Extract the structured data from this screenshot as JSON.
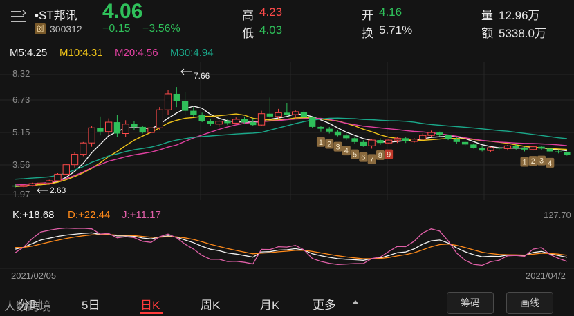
{
  "header": {
    "menu_icon": "list-menu-icon",
    "stock_name": "•ST邦讯",
    "badge": "创",
    "code": "300312",
    "price": "4.06",
    "change": "−0.15",
    "change_pct": "−3.56%",
    "high_label": "高",
    "high": "4.23",
    "low_label": "低",
    "low": "4.03",
    "open_label": "开",
    "open": "4.16",
    "turnover_label": "换",
    "turnover": "5.71%",
    "volume_label": "量",
    "volume": "12.96万",
    "amount_label": "额",
    "amount": "5338.0万",
    "colors": {
      "up": "#ff4a4a",
      "down": "#2fc05a",
      "bg": "#141414"
    }
  },
  "ma_legend": {
    "m5": "M5:4.25",
    "m10": "M10:4.31",
    "m20": "M20:4.56",
    "m30": "M30:4.94",
    "colors": {
      "m5": "#f2f2f2",
      "m10": "#f0c419",
      "m20": "#e040a0",
      "m30": "#1aa88a"
    }
  },
  "price_axis": {
    "t1": "8.32",
    "t2": "6.73",
    "t3": "5.15",
    "t4": "3.56",
    "t5": "1.97"
  },
  "annotations": {
    "high_mark": "7.66",
    "low_mark": "2.63"
  },
  "kdj": {
    "k": "K:+18.68",
    "d": "D:+22.44",
    "j": "J:+11.17",
    "axis_top": "127.70",
    "colors": {
      "k": "#f2f2f2",
      "d": "#ff8a1a",
      "j": "#e060a8"
    }
  },
  "dates": {
    "start": "2021/02/05",
    "end": "2021/04/2"
  },
  "tabs": [
    "分时",
    "5日",
    "日K",
    "周K",
    "月K",
    "更多"
  ],
  "active_tab": "日K",
  "buttons": {
    "chips": "筹码",
    "draw": "画线"
  },
  "watermark": "人数跨境",
  "chart_data": {
    "type": "candlestick",
    "ylim": [
      1.97,
      8.32
    ],
    "candles": [
      [
        2.45,
        2.55,
        2.35,
        2.4
      ],
      [
        2.4,
        2.5,
        2.3,
        2.45
      ],
      [
        2.45,
        2.6,
        2.4,
        2.55
      ],
      [
        2.55,
        2.6,
        2.5,
        2.58
      ],
      [
        2.58,
        2.75,
        2.55,
        2.7
      ],
      [
        2.7,
        3.1,
        2.68,
        3.05
      ],
      [
        3.05,
        3.6,
        3.0,
        3.55
      ],
      [
        3.55,
        4.2,
        3.4,
        4.1
      ],
      [
        4.1,
        4.75,
        4.0,
        4.7
      ],
      [
        4.7,
        5.6,
        4.5,
        5.5
      ],
      [
        5.5,
        6.1,
        5.1,
        5.3
      ],
      [
        5.3,
        6.0,
        5.1,
        5.8
      ],
      [
        5.8,
        6.2,
        5.0,
        5.2
      ],
      [
        5.2,
        5.9,
        5.0,
        5.7
      ],
      [
        5.7,
        5.85,
        5.4,
        5.55
      ],
      [
        5.55,
        5.6,
        5.2,
        5.25
      ],
      [
        5.25,
        5.6,
        5.15,
        5.5
      ],
      [
        5.5,
        6.6,
        5.4,
        6.45
      ],
      [
        6.45,
        7.5,
        6.2,
        7.3
      ],
      [
        7.3,
        7.66,
        6.6,
        6.9
      ],
      [
        6.9,
        7.4,
        6.2,
        6.4
      ],
      [
        6.4,
        6.6,
        6.1,
        6.2
      ],
      [
        6.2,
        6.3,
        5.8,
        5.85
      ],
      [
        5.85,
        5.95,
        5.6,
        5.7
      ],
      [
        5.7,
        5.9,
        5.55,
        5.85
      ],
      [
        5.85,
        5.95,
        5.65,
        5.75
      ],
      [
        5.75,
        6.05,
        5.7,
        5.95
      ],
      [
        5.95,
        6.1,
        5.7,
        5.8
      ],
      [
        5.8,
        6.0,
        5.6,
        5.65
      ],
      [
        5.65,
        6.4,
        5.6,
        6.25
      ],
      [
        6.25,
        7.1,
        6.0,
        6.1
      ],
      [
        6.1,
        6.5,
        5.95,
        6.3
      ],
      [
        6.3,
        6.8,
        6.15,
        6.2
      ],
      [
        6.2,
        6.45,
        6.0,
        6.35
      ],
      [
        6.35,
        6.45,
        6.0,
        6.05
      ],
      [
        6.05,
        6.1,
        5.5,
        5.55
      ],
      [
        5.55,
        5.6,
        5.3,
        5.45
      ],
      [
        5.45,
        5.55,
        5.2,
        5.3
      ],
      [
        5.3,
        5.4,
        5.05,
        5.1
      ],
      [
        5.1,
        5.2,
        4.85,
        4.95
      ],
      [
        4.95,
        5.05,
        4.65,
        4.75
      ],
      [
        4.75,
        4.85,
        4.5,
        4.55
      ],
      [
        4.55,
        4.9,
        4.4,
        4.85
      ],
      [
        4.85,
        4.95,
        4.6,
        4.7
      ],
      [
        4.7,
        4.9,
        4.65,
        4.85
      ],
      [
        4.85,
        5.0,
        4.7,
        4.95
      ],
      [
        4.95,
        5.0,
        4.7,
        4.78
      ],
      [
        4.78,
        4.95,
        4.72,
        4.9
      ],
      [
        4.9,
        5.2,
        4.85,
        5.1
      ],
      [
        5.1,
        5.35,
        5.0,
        5.25
      ],
      [
        5.25,
        5.3,
        5.05,
        5.12
      ],
      [
        5.12,
        5.15,
        4.85,
        4.92
      ],
      [
        4.92,
        5.0,
        4.65,
        4.75
      ],
      [
        4.75,
        4.8,
        4.55,
        4.62
      ],
      [
        4.62,
        4.68,
        4.4,
        4.45
      ],
      [
        4.45,
        4.55,
        4.25,
        4.3
      ],
      [
        4.3,
        4.5,
        4.2,
        4.45
      ],
      [
        4.45,
        4.55,
        4.3,
        4.4
      ],
      [
        4.4,
        4.6,
        4.3,
        4.55
      ],
      [
        4.55,
        4.65,
        4.35,
        4.42
      ],
      [
        4.42,
        4.5,
        4.25,
        4.35
      ],
      [
        4.35,
        4.55,
        4.3,
        4.5
      ],
      [
        4.5,
        4.55,
        4.32,
        4.4
      ],
      [
        4.4,
        4.45,
        4.2,
        4.25
      ],
      [
        4.25,
        4.35,
        4.15,
        4.2
      ],
      [
        4.2,
        4.23,
        4.03,
        4.06
      ]
    ]
  }
}
